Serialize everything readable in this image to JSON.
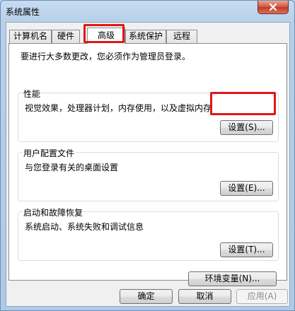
{
  "window": {
    "title": "系统属性"
  },
  "tabs": [
    {
      "label": "计算机名",
      "active": false
    },
    {
      "label": "硬件",
      "active": false
    },
    {
      "label": "高级",
      "active": true
    },
    {
      "label": "系统保护",
      "active": false
    },
    {
      "label": "远程",
      "active": false
    }
  ],
  "advanced": {
    "admin_notice": "要进行大多数更改，您必须作为管理员登录。",
    "performance": {
      "title": "性能",
      "description": "视觉效果，处理器计划，内存使用，以及虚拟内存",
      "button": "设置(S)..."
    },
    "user_profiles": {
      "title": "用户配置文件",
      "description": "与您登录有关的桌面设置",
      "button": "设置(E)..."
    },
    "startup_recovery": {
      "title": "启动和故障恢复",
      "description": "系统启动、系统失败和调试信息",
      "button": "设置(T)..."
    },
    "env_vars_button": "环境变量(N)..."
  },
  "footer": {
    "ok": "确定",
    "cancel": "取消",
    "apply": "应用(A)"
  },
  "colors": {
    "highlight": "#e01717"
  }
}
